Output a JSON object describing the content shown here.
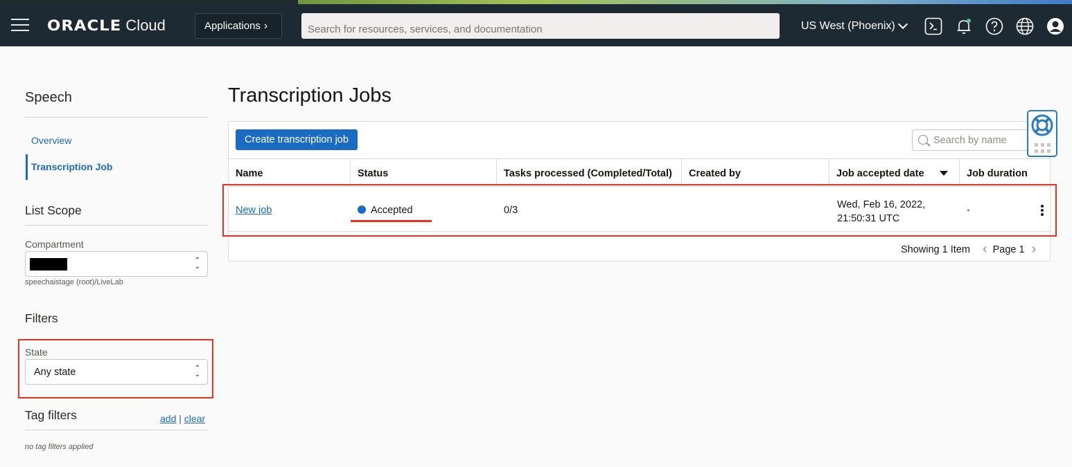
{
  "header": {
    "logo_brand": "ORACLE",
    "logo_product": "Cloud",
    "applications_label": "Applications",
    "search_placeholder": "Search for resources, services, and documentation",
    "region": "US West (Phoenix)",
    "icons": [
      "menu-icon",
      "cloud-shell-icon",
      "bell-icon",
      "help-icon",
      "globe-icon",
      "profile-icon"
    ]
  },
  "sidebar": {
    "title": "Speech",
    "nav": [
      {
        "label": "Overview",
        "active": false
      },
      {
        "label": "Transcription Job",
        "active": true
      }
    ],
    "list_scope": {
      "title": "List Scope",
      "compartment_label": "Compartment",
      "compartment_path": "speechaistage (root)/LiveLab"
    },
    "filters": {
      "title": "Filters",
      "state_label": "State",
      "state_value": "Any state"
    },
    "tag_filters": {
      "title": "Tag filters",
      "add": "add",
      "separator": "|",
      "clear": "clear",
      "empty": "no tag filters applied"
    }
  },
  "main": {
    "title": "Transcription Jobs",
    "create_button": "Create transcription job",
    "search_placeholder": "Search by name",
    "columns": [
      "Name",
      "Status",
      "Tasks processed (Completed/Total)",
      "Created by",
      "Job accepted date",
      "Job duration"
    ],
    "rows": [
      {
        "name": "New job",
        "status": "Accepted",
        "tasks": "0/3",
        "created_by": "",
        "accepted_date_line1": "Wed, Feb 16, 2022,",
        "accepted_date_line2": "21:50:31 UTC",
        "duration": "-"
      }
    ],
    "pager": {
      "showing": "Showing 1 Item",
      "page": "Page 1"
    }
  },
  "colors": {
    "header_bg": "#1e2a33",
    "accent_blue": "#1a6bc1",
    "highlight_red": "#e8321f",
    "status_accepted": "#1a6bc1"
  }
}
